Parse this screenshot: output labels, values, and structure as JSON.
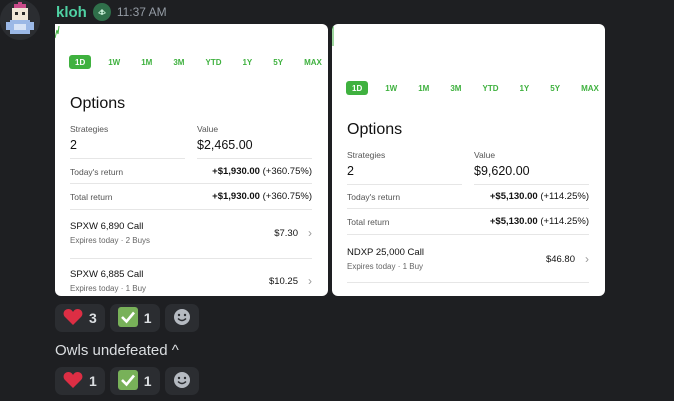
{
  "message": {
    "username": "kloh",
    "timestamp": "11:37 AM",
    "text2": "Owls undefeated ^"
  },
  "colors": {
    "username": "#4fd1a3",
    "accent_green": "#3fb13f",
    "background": "#1e1f22"
  },
  "card1": {
    "ranges": [
      "1D",
      "1W",
      "1M",
      "3M",
      "YTD",
      "1Y",
      "5Y",
      "MAX"
    ],
    "active_range": "1D",
    "title": "Options",
    "strategies_label": "Strategies",
    "strategies_value": "2",
    "value_label": "Value",
    "value_value": "$2,465.00",
    "todays_return_label": "Today's return",
    "todays_return_amount": "+$1,930.00",
    "todays_return_pct": "(+360.75%)",
    "total_return_label": "Total return",
    "total_return_amount": "+$1,930.00",
    "total_return_pct": "(+360.75%)",
    "positions": [
      {
        "name": "SPXW 6,890 Call",
        "sub": "Expires today · 2 Buys",
        "price": "$7.30"
      },
      {
        "name": "SPXW 6,885 Call",
        "sub": "Expires today · 1 Buy",
        "price": "$10.25"
      }
    ]
  },
  "card2": {
    "ranges": [
      "1D",
      "1W",
      "1M",
      "3M",
      "YTD",
      "1Y",
      "5Y",
      "MAX"
    ],
    "active_range": "1D",
    "title": "Options",
    "strategies_label": "Strategies",
    "strategies_value": "2",
    "value_label": "Value",
    "value_value": "$9,620.00",
    "todays_return_label": "Today's return",
    "todays_return_amount": "+$5,130.00",
    "todays_return_pct": "(+114.25%)",
    "total_return_label": "Total return",
    "total_return_amount": "+$5,130.00",
    "total_return_pct": "(+114.25%)",
    "positions": [
      {
        "name": "NDXP 25,000 Call",
        "sub": "Expires today · 1 Buy",
        "price": "$46.80"
      }
    ]
  },
  "reactions1": [
    {
      "emoji": "❤",
      "count": "3",
      "icon": "heart-icon"
    },
    {
      "emoji": "✔",
      "count": "1",
      "icon": "check-mark-icon"
    }
  ],
  "reactions2": [
    {
      "emoji": "❤",
      "count": "1",
      "icon": "heart-icon"
    },
    {
      "emoji": "✔",
      "count": "1",
      "icon": "check-mark-icon"
    }
  ]
}
